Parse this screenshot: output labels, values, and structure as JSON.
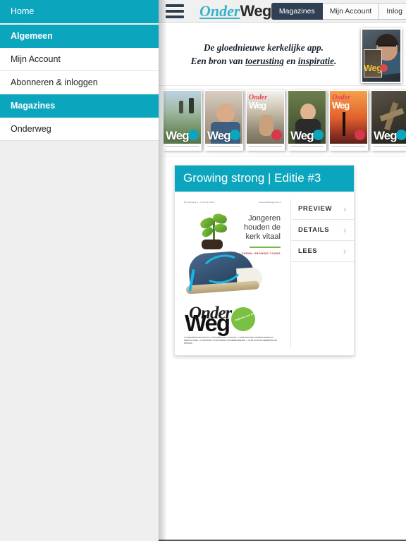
{
  "sidebar": {
    "items": [
      {
        "label": "Home",
        "style": "teal",
        "name": "sidebar-item-home"
      },
      {
        "label": "Algemeen",
        "style": "teal-header",
        "name": "sidebar-item-algemeen"
      },
      {
        "label": "Mijn Account",
        "style": "plain",
        "name": "sidebar-item-mijn-account"
      },
      {
        "label": "Abonneren & inloggen",
        "style": "plain",
        "name": "sidebar-item-abonneren"
      },
      {
        "label": "Magazines",
        "style": "teal-header",
        "name": "sidebar-item-magazines"
      },
      {
        "label": "Onderweg",
        "style": "plain",
        "name": "sidebar-item-onderweg"
      }
    ]
  },
  "topbar": {
    "menu_icon": "hamburger-icon",
    "logo": {
      "part1": "Onder",
      "part2": "Weg"
    },
    "tabs": [
      {
        "label": "Magazines",
        "active": true
      },
      {
        "label": "Mijn Account",
        "active": false
      },
      {
        "label": "Inlog",
        "active": false
      }
    ]
  },
  "banner": {
    "line1": "De gloednieuwe kerkelijke app.",
    "line2_before": "Een bron van ",
    "line2_link1": "toerusting",
    "line2_mid": " en ",
    "line2_link2": "inspiratie",
    "line2_after": ".",
    "photo_caption": "Weg"
  },
  "shelf": {
    "covers": [
      {
        "name": "magazine-cover-1",
        "art": "art-hikers",
        "word": "Weg",
        "badge": "teal"
      },
      {
        "name": "magazine-cover-2",
        "art": "art-man",
        "word": "Weg",
        "badge": "teal"
      },
      {
        "name": "magazine-cover-3",
        "art": "art-woman",
        "word": "Weg",
        "badge": "red",
        "top1": "Onder",
        "top2": "Weg"
      },
      {
        "name": "magazine-cover-4",
        "art": "art-girl",
        "word": "Weg",
        "badge": "teal"
      },
      {
        "name": "magazine-cover-5",
        "art": "art-sunset",
        "word": "",
        "badge": "red",
        "top1": "Onder",
        "top2": "Weg"
      },
      {
        "name": "magazine-cover-6",
        "art": "art-cross",
        "word": "Weg",
        "badge": "teal"
      }
    ]
  },
  "card": {
    "title": "Growing strong | Editie #3",
    "cover": {
      "topline_left": "#03 jaargang 4 - 3 februari 2018",
      "topline_url": "www.onderwegonline.nl",
      "headline": "Jongeren houden de kerk vitaal",
      "subtitle": "THEMA: GROWING YOUNG",
      "logo_part1": "Onder",
      "logo_part2": "Weg",
      "badge_text": "Inspiratie voor onderweg",
      "footer": "IN ONDERZOEK DE PRAKTIJK VOOR BEZIELING, VITALITEIT + LEGER DES HEILS KERKEN KERKELIJK WERKTE NODIG + IN GROWING YOUNG REIZEN JONGEREN MEE MET + JIJ EN JOUW DE GEMEENTE VAN MORGEN"
    },
    "actions": [
      {
        "label": "PREVIEW",
        "icon": "chevron-right-icon"
      },
      {
        "label": "DETAILS",
        "icon": "chevron-right-icon"
      },
      {
        "label": "LEES",
        "icon": "chevron-right-icon"
      }
    ]
  },
  "colors": {
    "teal": "#0ba6be",
    "tab_active": "#2f4054",
    "sidebar_bg": "#efefef"
  }
}
